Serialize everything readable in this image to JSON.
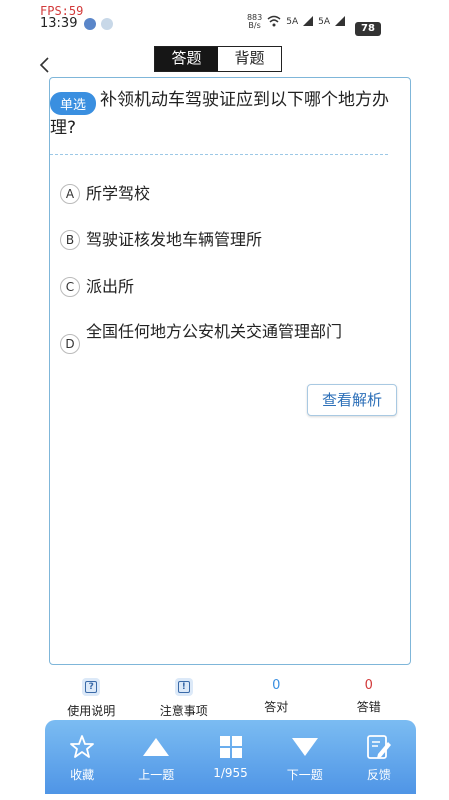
{
  "overlay": {
    "fps": "FPS:59"
  },
  "status": {
    "time": "13:39",
    "net_speed": "883\nB/s",
    "sig1": "5A",
    "sig2": "5A",
    "battery": "78"
  },
  "tabs": [
    {
      "label": "答题"
    },
    {
      "label": "背题"
    }
  ],
  "question": {
    "type_tag": "单选",
    "text": "补领机动车驾驶证应到以下哪个地方办理?"
  },
  "options": [
    {
      "letter": "A",
      "text": "所学驾校"
    },
    {
      "letter": "B",
      "text": "驾驶证核发地车辆管理所"
    },
    {
      "letter": "C",
      "text": "派出所"
    },
    {
      "letter": "D",
      "text": "全国任何地方公安机关交通管理部门"
    }
  ],
  "analysis_button": "查看解析",
  "stats": {
    "help_label": "使用说明",
    "notes_label": "注意事项",
    "correct_count": "0",
    "correct_label": "答对",
    "wrong_count": "0",
    "wrong_label": "答错"
  },
  "bottom_nav": {
    "favorite": "收藏",
    "prev": "上一题",
    "progress": "1/955",
    "next": "下一题",
    "feedback": "反馈"
  },
  "colors": {
    "accent": "#3a8fe0",
    "correct": "#3a8fe0",
    "wrong": "#d23b3b",
    "card_border": "#7fb6d9"
  },
  "icons": [
    "back-arrow-icon",
    "question-doc-icon",
    "notice-doc-icon",
    "star-icon",
    "triangle-up-icon",
    "grid-icon",
    "triangle-down-icon",
    "edit-icon"
  ]
}
